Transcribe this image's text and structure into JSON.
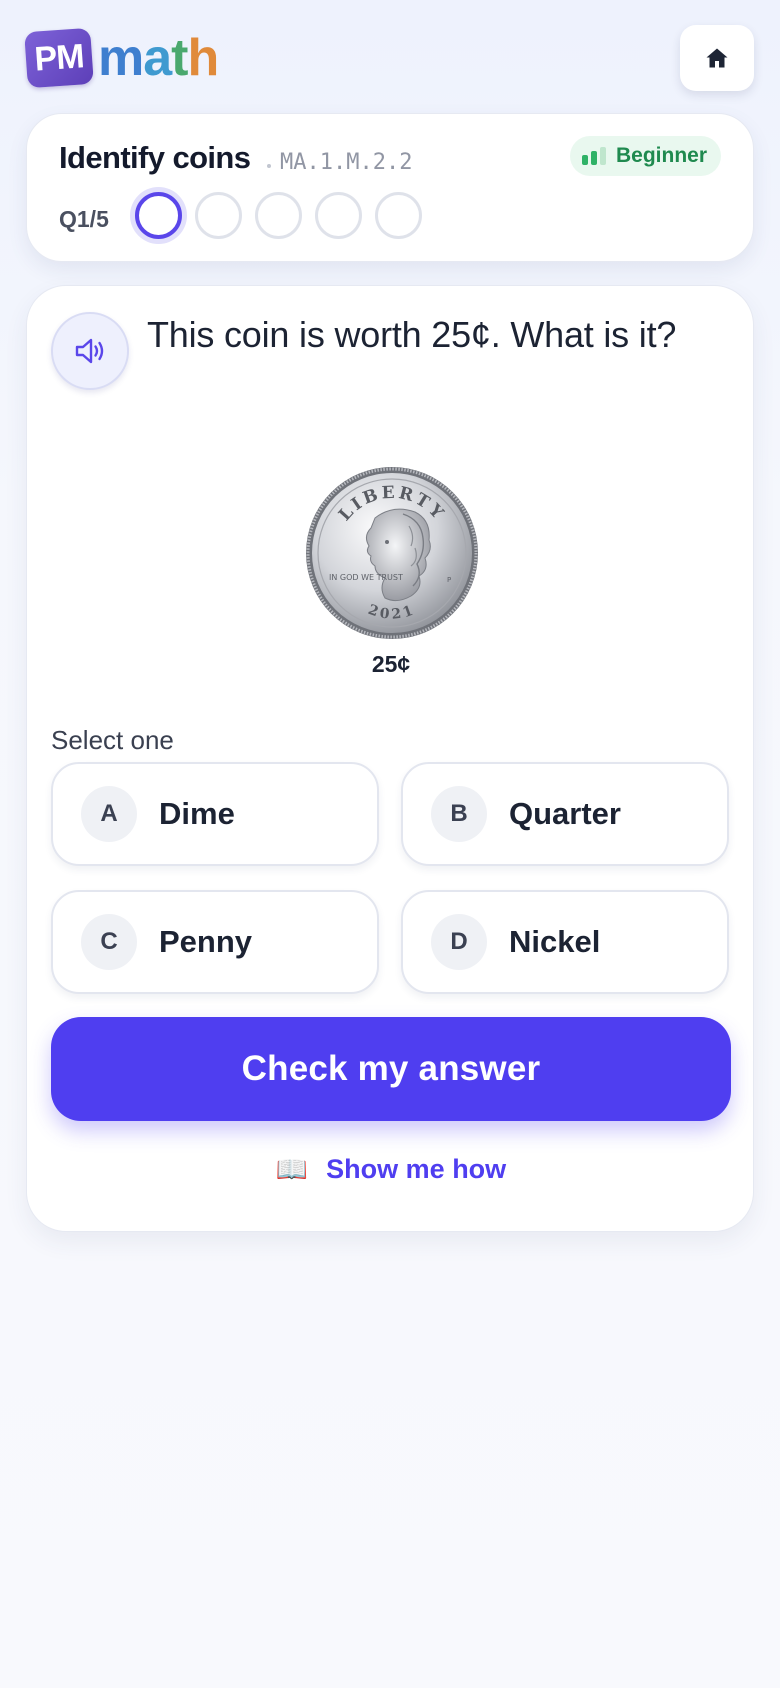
{
  "header": {
    "logo_badge": "PM",
    "logo_letters": [
      "m",
      "a",
      "t",
      "h"
    ],
    "home_icon": "home-icon"
  },
  "topic": {
    "title": "Identify coins",
    "code": "MA.1.M.2.2",
    "level": "Beginner",
    "level_icon": "signal-bars-icon",
    "question_label": "Q1/5",
    "progress": {
      "current": 1,
      "total": 5
    }
  },
  "question": {
    "speaker_icon": "speaker-icon",
    "text": "This coin is worth 25¢. What is it?",
    "coin": {
      "arc_text": "LIBERTY",
      "motto": "IN GOD WE TRUST",
      "year": "2021",
      "mint": "P",
      "caption": "25¢"
    },
    "select_label": "Select one",
    "options": [
      {
        "letter": "A",
        "label": "Dime"
      },
      {
        "letter": "B",
        "label": "Quarter"
      },
      {
        "letter": "C",
        "label": "Penny"
      },
      {
        "letter": "D",
        "label": "Nickel"
      }
    ],
    "check_button": "Check my answer",
    "show_how": {
      "icon": "📖",
      "label": "Show me how"
    }
  },
  "colors": {
    "primary": "#4f3ef0",
    "level_green": "#1f8a4f",
    "level_bg": "#e9f8ef"
  }
}
